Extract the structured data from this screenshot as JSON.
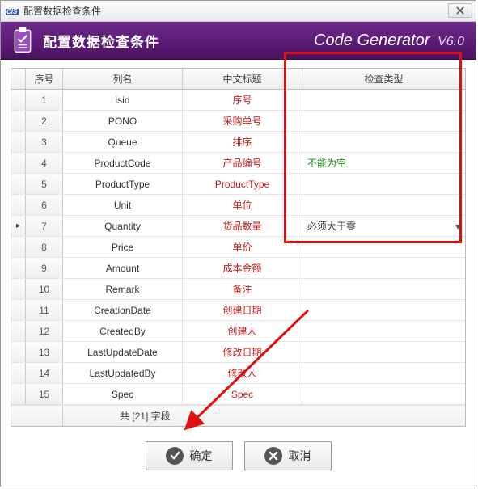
{
  "titlebar": {
    "title": "配置数据检查条件"
  },
  "banner": {
    "title": "配置数据检查条件",
    "brand": "Code Generator",
    "version": "V6.0"
  },
  "headers": {
    "seq": "序号",
    "name": "列名",
    "title": "中文标题",
    "check": "检查类型"
  },
  "rows": [
    {
      "seq": "1",
      "name": "isid",
      "title": "序号",
      "check": "",
      "checkClass": "",
      "active": false,
      "caret": false
    },
    {
      "seq": "2",
      "name": "PONO",
      "title": "采购单号",
      "check": "",
      "checkClass": "",
      "active": false,
      "caret": false
    },
    {
      "seq": "3",
      "name": "Queue",
      "title": "排序",
      "check": "",
      "checkClass": "",
      "active": false,
      "caret": false
    },
    {
      "seq": "4",
      "name": "ProductCode",
      "title": "产品编号",
      "check": "不能为空",
      "checkClass": "green",
      "active": false,
      "caret": false
    },
    {
      "seq": "5",
      "name": "ProductType",
      "title": "ProductType",
      "check": "",
      "checkClass": "",
      "active": false,
      "caret": false
    },
    {
      "seq": "6",
      "name": "Unit",
      "title": "单位",
      "check": "",
      "checkClass": "",
      "active": false,
      "caret": false
    },
    {
      "seq": "7",
      "name": "Quantity",
      "title": "货品数量",
      "check": "必须大于零",
      "checkClass": "",
      "active": true,
      "caret": true
    },
    {
      "seq": "8",
      "name": "Price",
      "title": "单价",
      "check": "",
      "checkClass": "",
      "active": false,
      "caret": false
    },
    {
      "seq": "9",
      "name": "Amount",
      "title": "成本金额",
      "check": "",
      "checkClass": "",
      "active": false,
      "caret": false
    },
    {
      "seq": "10",
      "name": "Remark",
      "title": "备注",
      "check": "",
      "checkClass": "",
      "active": false,
      "caret": false
    },
    {
      "seq": "11",
      "name": "CreationDate",
      "title": "创建日期",
      "check": "",
      "checkClass": "",
      "active": false,
      "caret": false
    },
    {
      "seq": "12",
      "name": "CreatedBy",
      "title": "创建人",
      "check": "",
      "checkClass": "",
      "active": false,
      "caret": false
    },
    {
      "seq": "13",
      "name": "LastUpdateDate",
      "title": "修改日期",
      "check": "",
      "checkClass": "",
      "active": false,
      "caret": false
    },
    {
      "seq": "14",
      "name": "LastUpdatedBy",
      "title": "修改人",
      "check": "",
      "checkClass": "",
      "active": false,
      "caret": false
    },
    {
      "seq": "15",
      "name": "Spec",
      "title": "Spec",
      "check": "",
      "checkClass": "",
      "active": false,
      "caret": false
    }
  ],
  "footer": {
    "text": "共 [21] 字段"
  },
  "buttons": {
    "ok": "确定",
    "cancel": "取消"
  }
}
